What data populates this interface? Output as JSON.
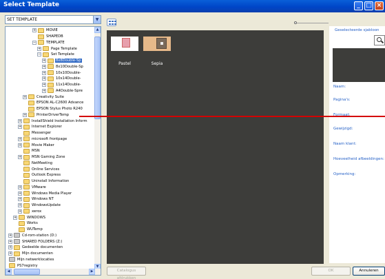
{
  "window": {
    "title": "Select Template"
  },
  "folder_dropdown": {
    "value": "SET TEMPLATE"
  },
  "tree": {
    "items": [
      {
        "label": "MOVIE",
        "indent": 5,
        "exp": "+",
        "selected": false,
        "type": "folder"
      },
      {
        "label": "SHAPEDB",
        "indent": 5,
        "exp": "",
        "selected": false,
        "type": "folder"
      },
      {
        "label": "TEMPLATE",
        "indent": 5,
        "exp": "−",
        "selected": false,
        "type": "folder"
      },
      {
        "label": "Page Template",
        "indent": 6,
        "exp": "+",
        "selected": false,
        "type": "folder"
      },
      {
        "label": "Set Template",
        "indent": 6,
        "exp": "−",
        "selected": false,
        "type": "folder"
      },
      {
        "label": "8x8Double-Sp",
        "indent": 7,
        "exp": "+",
        "selected": true,
        "type": "folder"
      },
      {
        "label": "8x10Double-Sp",
        "indent": 7,
        "exp": "+",
        "selected": false,
        "type": "folder"
      },
      {
        "label": "10x10Double-",
        "indent": 7,
        "exp": "+",
        "selected": false,
        "type": "folder"
      },
      {
        "label": "10x14Double-",
        "indent": 7,
        "exp": "+",
        "selected": false,
        "type": "folder"
      },
      {
        "label": "11x14Double-",
        "indent": 7,
        "exp": "+",
        "selected": false,
        "type": "folder"
      },
      {
        "label": "A4Double-Spre",
        "indent": 7,
        "exp": "+",
        "selected": false,
        "type": "folder"
      },
      {
        "label": "Creativity Suite",
        "indent": 3,
        "exp": "+",
        "selected": false,
        "type": "folder"
      },
      {
        "label": "EPSON AL-C2600 Advance",
        "indent": 3,
        "exp": "",
        "selected": false,
        "type": "folder"
      },
      {
        "label": "EPSON Stylus Photo R240",
        "indent": 3,
        "exp": "",
        "selected": false,
        "type": "folder"
      },
      {
        "label": "PrinterDriverTemp",
        "indent": 3,
        "exp": "+",
        "selected": false,
        "type": "folder"
      },
      {
        "label": "InstallShield Installation Inform",
        "indent": 2,
        "exp": "+",
        "selected": false,
        "type": "folder"
      },
      {
        "label": "Internet Explorer",
        "indent": 2,
        "exp": "+",
        "selected": false,
        "type": "folder"
      },
      {
        "label": "Messenger",
        "indent": 2,
        "exp": "",
        "selected": false,
        "type": "folder"
      },
      {
        "label": "microsoft frontpage",
        "indent": 2,
        "exp": "+",
        "selected": false,
        "type": "folder"
      },
      {
        "label": "Movie Maker",
        "indent": 2,
        "exp": "+",
        "selected": false,
        "type": "folder"
      },
      {
        "label": "MSN",
        "indent": 2,
        "exp": "",
        "selected": false,
        "type": "folder"
      },
      {
        "label": "MSN Gaming Zone",
        "indent": 2,
        "exp": "+",
        "selected": false,
        "type": "folder"
      },
      {
        "label": "NetMeeting",
        "indent": 2,
        "exp": "",
        "selected": false,
        "type": "folder"
      },
      {
        "label": "Online Services",
        "indent": 2,
        "exp": "",
        "selected": false,
        "type": "folder"
      },
      {
        "label": "Outlook Express",
        "indent": 2,
        "exp": "",
        "selected": false,
        "type": "folder"
      },
      {
        "label": "Uninstall Information",
        "indent": 2,
        "exp": "",
        "selected": false,
        "type": "folder"
      },
      {
        "label": "VMware",
        "indent": 2,
        "exp": "+",
        "selected": false,
        "type": "folder"
      },
      {
        "label": "Windows Media Player",
        "indent": 2,
        "exp": "+",
        "selected": false,
        "type": "folder"
      },
      {
        "label": "Windows NT",
        "indent": 2,
        "exp": "+",
        "selected": false,
        "type": "folder"
      },
      {
        "label": "WindowsUpdate",
        "indent": 2,
        "exp": "+",
        "selected": false,
        "type": "folder"
      },
      {
        "label": "xerox",
        "indent": 2,
        "exp": "+",
        "selected": false,
        "type": "folder"
      },
      {
        "label": "WINDOWS",
        "indent": 1,
        "exp": "+",
        "selected": false,
        "type": "folder"
      },
      {
        "label": "Works",
        "indent": 1,
        "exp": "",
        "selected": false,
        "type": "folder"
      },
      {
        "label": "WUTemp",
        "indent": 1,
        "exp": "",
        "selected": false,
        "type": "folder"
      },
      {
        "label": "Cd-rom-station (D:)",
        "indent": 0,
        "exp": "+",
        "selected": false,
        "type": "drive"
      },
      {
        "label": "SHARED FOLDERS (Z:)",
        "indent": 0,
        "exp": "+",
        "selected": false,
        "type": "drive"
      },
      {
        "label": "Gedeelde documenten",
        "indent": 0,
        "exp": "+",
        "selected": false,
        "type": "folder"
      },
      {
        "label": "Mijn documenten",
        "indent": 0,
        "exp": "+",
        "selected": false,
        "type": "folder"
      },
      {
        "label": "Mijn netwerklocaties",
        "indent": -1,
        "exp": "",
        "selected": false,
        "type": "drive"
      },
      {
        "label": "PS7registry",
        "indent": -1,
        "exp": "",
        "selected": false,
        "type": "folder"
      }
    ]
  },
  "gallery": {
    "templates": [
      {
        "name": "Pastel"
      },
      {
        "name": "Sepia"
      }
    ]
  },
  "buttons": {
    "print_catalog": "Catalogus afdrukken",
    "ok": "OK",
    "cancel": "Annuleren"
  },
  "details": {
    "title": "Geselecteerde sjabloon",
    "fields": [
      {
        "label": "Naam:"
      },
      {
        "label": "Pagina's:"
      },
      {
        "label": "Formaat:"
      },
      {
        "label": "Gewijzigd:"
      },
      {
        "label": "Naam klant:"
      },
      {
        "label": "Hoeveelheid afbeeldingen:"
      },
      {
        "label": "Opmerking:"
      }
    ]
  },
  "colors": {
    "titlebar": "#0046c8",
    "gallery_background": "#3d3d3a",
    "detail_label": "#235fc6",
    "selection": "#316ac5",
    "annotation_line": "#d40000"
  }
}
